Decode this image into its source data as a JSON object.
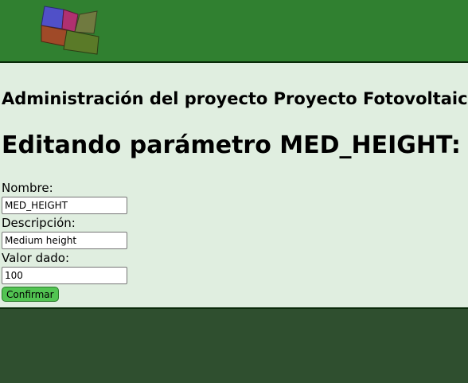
{
  "header": {
    "logo_icon": "solar-panels-logo-icon",
    "background": "#308030"
  },
  "main": {
    "project_title": "Administración del proyecto Proyecto Fotovoltaico",
    "edit_title": "Editando parámetro MED_HEIGHT:",
    "form": {
      "name_label": "Nombre:",
      "name_value": "MED_HEIGHT",
      "description_label": "Descripción:",
      "description_value": "Medium height",
      "value_label": "Valor dado:",
      "value_value": "100",
      "confirm_label": "Confirmar"
    },
    "background": "#e0eee0"
  },
  "colors": {
    "header": "#308030",
    "content": "#e0eee0",
    "footer": "#2f4f2f",
    "button": "#52c452"
  }
}
